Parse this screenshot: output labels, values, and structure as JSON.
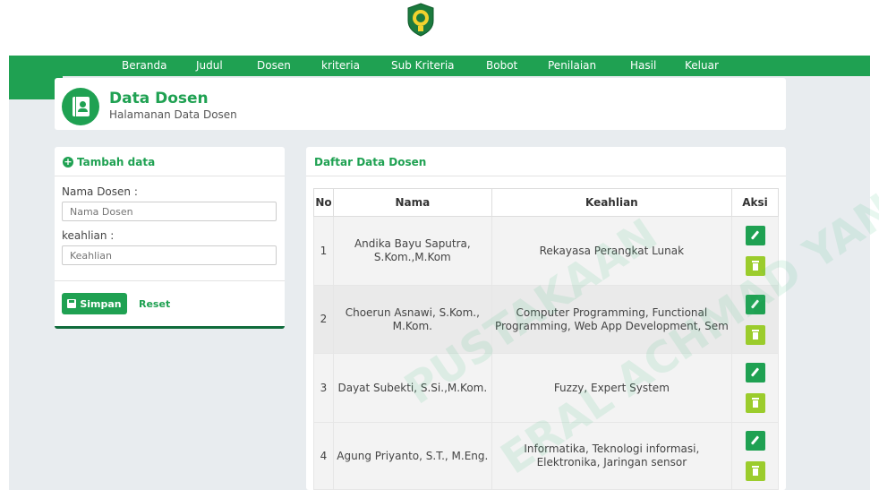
{
  "nav": {
    "items": [
      {
        "label": "Beranda"
      },
      {
        "label": "Judul"
      },
      {
        "label": "Dosen"
      },
      {
        "label": "kriteria"
      },
      {
        "label": "Sub Kriteria"
      },
      {
        "label": "Bobot"
      },
      {
        "label": "Penilaian"
      },
      {
        "label": "Hasil"
      },
      {
        "label": "Keluar"
      }
    ]
  },
  "header": {
    "title": "Data Dosen",
    "subtitle": "Halamanan Data Dosen"
  },
  "form": {
    "title": "Tambah data",
    "nama_label": "Nama Dosen :",
    "nama_placeholder": "Nama Dosen",
    "keahlian_label": "keahlian :",
    "keahlian_placeholder": "Keahlian",
    "save_label": "Simpan",
    "reset_label": "Reset"
  },
  "list": {
    "title": "Daftar Data Dosen",
    "columns": [
      "No",
      "Nama",
      "Keahlian",
      "Aksi"
    ],
    "rows": [
      {
        "no": "1",
        "nama": "Andika Bayu Saputra, S.Kom.,M.Kom",
        "keahlian": "Rekayasa Perangkat Lunak"
      },
      {
        "no": "2",
        "nama": "Choerun Asnawi, S.Kom., M.Kom.",
        "keahlian": "Computer Programming, Functional Programming, Web App Development, Sem"
      },
      {
        "no": "3",
        "nama": "Dayat Subekti, S.Si.,M.Kom.",
        "keahlian": "Fuzzy, Expert System"
      },
      {
        "no": "4",
        "nama": "Agung Priyanto, S.T., M.Eng.",
        "keahlian": "Informatika, Teknologi informasi, Elektronika, Jaringan sensor"
      }
    ]
  },
  "colors": {
    "brand": "#1fa152",
    "delete": "#9bcc2c",
    "background": "#e8ecef"
  }
}
